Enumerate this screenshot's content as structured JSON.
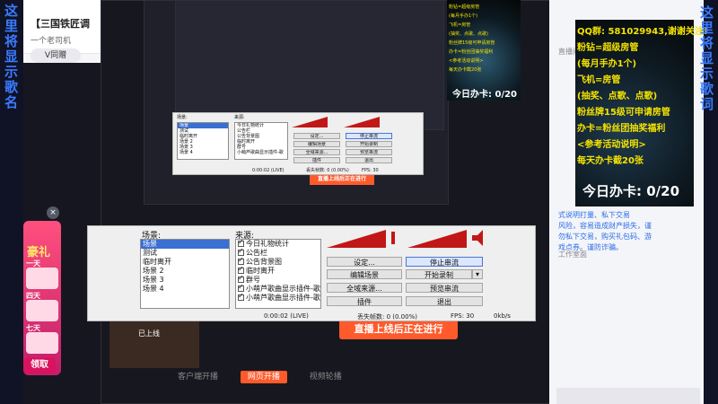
{
  "left_banner": "这里将显示歌名",
  "right_banner": "这里将显示歌词",
  "bg_page": {
    "title": "【三国铁匠调",
    "subtitle": "一个老司机",
    "v_badge": "V同赠"
  },
  "gift_panel": {
    "title": "豪礼",
    "slots": [
      "一天",
      "四天",
      "七天"
    ],
    "claim": "领取",
    "close": "×"
  },
  "stream": {
    "go_live": "直播上线后正在进行",
    "go_live_small": "直播上线后正在进行",
    "cover_label": "已上线",
    "tabs": [
      "客户端开播",
      "网页开播",
      "视频轮播"
    ]
  },
  "obs": {
    "scenes_label": "场景:",
    "sources_label": "来源:",
    "scenes": [
      "场景",
      "测试",
      "临时离开",
      "场景 2",
      "场景 3",
      "场景 4"
    ],
    "sources": [
      "今日礼物统计",
      "公告栏",
      "公告背景图",
      "临时离开",
      "群号",
      "小萌芦歌曲显示插件-歌",
      "小萌芦歌曲显示插件-歌"
    ],
    "buttons": {
      "settings": "设定...",
      "stop_stream": "停止串流",
      "edit_scene": "编辑场景",
      "start_record": "开始录制",
      "global_sources": "全域来源...",
      "preview_stream": "预览串流",
      "plugins": "插件",
      "exit": "退出"
    },
    "status": {
      "time": "0:00:02 (LIVE)",
      "dropped": "丢失帧数: 0 (0.00%)",
      "fps": "FPS: 30",
      "bitrate": "0kb/s"
    }
  },
  "overlay": {
    "qq": "QQ群: 581029943,谢谢关注!",
    "lines": [
      "粉钻=超级房管",
      "(每月手办1个)",
      "飞机=房管",
      "(抽奖、点歌、点歌)",
      "粉丝牌15级可申请房管",
      "办卡=粉丝团抽奖福利",
      "<参考活动说明>",
      "每天办卡截20张"
    ],
    "daily": "今日办卡: 0/20"
  },
  "right_page": {
    "lines": [
      "直播间",
      "式说明打量、私下交易",
      "风险，容易造成财产损失，谨",
      "勿私下交易，购买礼包码、游",
      "戏点券。谨防诈骗。"
    ],
    "work_label": "工作室面"
  }
}
